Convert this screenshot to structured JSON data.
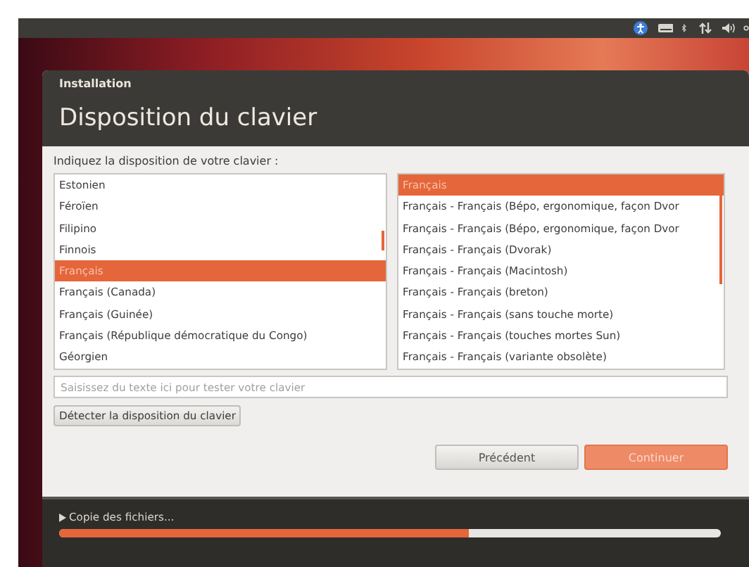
{
  "window": {
    "title": "Installation",
    "heading": "Disposition du clavier"
  },
  "prompt": "Indiquez la disposition de votre clavier :",
  "layouts": [
    {
      "label": "Estonien",
      "selected": false
    },
    {
      "label": "Féroïen",
      "selected": false
    },
    {
      "label": "Filipino",
      "selected": false
    },
    {
      "label": "Finnois",
      "selected": false
    },
    {
      "label": "Français",
      "selected": true
    },
    {
      "label": "Français (Canada)",
      "selected": false
    },
    {
      "label": "Français (Guinée)",
      "selected": false
    },
    {
      "label": "Français (République démocratique du Congo)",
      "selected": false
    },
    {
      "label": "Géorgien",
      "selected": false
    }
  ],
  "variants": [
    {
      "label": "Français",
      "selected": true
    },
    {
      "label": "Français - Français (Bépo, ergonomique, façon Dvor",
      "selected": false
    },
    {
      "label": "Français - Français (Bépo, ergonomique, façon Dvor",
      "selected": false
    },
    {
      "label": "Français - Français (Dvorak)",
      "selected": false
    },
    {
      "label": "Français - Français (Macintosh)",
      "selected": false
    },
    {
      "label": "Français - Français (breton)",
      "selected": false
    },
    {
      "label": "Français - Français (sans touche morte)",
      "selected": false
    },
    {
      "label": "Français - Français (touches mortes Sun)",
      "selected": false
    },
    {
      "label": "Français - Français (variante obsolète)",
      "selected": false
    }
  ],
  "test_field": {
    "placeholder": "Saisissez du texte ici pour tester votre clavier"
  },
  "detect_button": "Détecter la disposition du clavier",
  "buttons": [
    {
      "label": "Précédent",
      "kind": "secondary"
    },
    {
      "label": "Continuer",
      "kind": "primary"
    }
  ],
  "progress": {
    "label": "Copie des fichiers...",
    "level": 0.62
  }
}
